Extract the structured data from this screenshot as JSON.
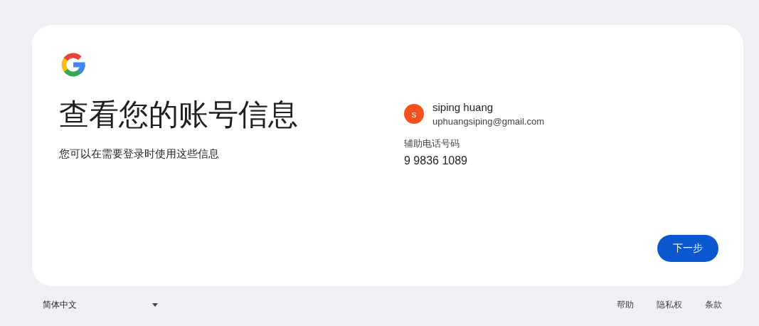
{
  "card": {
    "title": "查看您的账号信息",
    "subtitle": "您可以在需要登录时使用这些信息",
    "account": {
      "initial": "s",
      "name": "siping huang",
      "email": "uphuangsiping@gmail.com"
    },
    "phone": {
      "label": "辅助电话号码",
      "value": "9 9836 1089"
    },
    "next_button": "下一步"
  },
  "footer": {
    "language": "简体中文",
    "links": [
      "帮助",
      "隐私权",
      "条款"
    ]
  }
}
